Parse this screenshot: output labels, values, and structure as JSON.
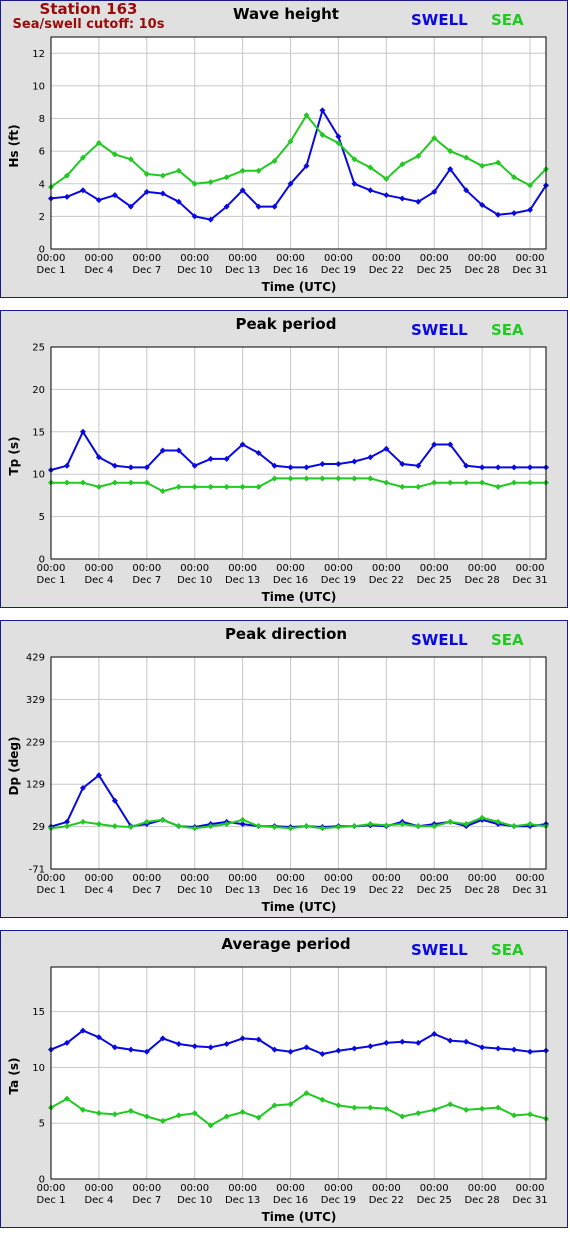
{
  "header": {
    "station": "Station 163",
    "cutoff": "Sea/swell cutoff: 10s"
  },
  "legend": {
    "swell": "SWELL",
    "sea": "SEA"
  },
  "colors": {
    "swell": "#0a0ae0",
    "sea": "#22c922",
    "header": "#9b0a0a",
    "border": "#1a1a8c"
  },
  "x_axis": {
    "label": "Time (UTC)",
    "ticks": [
      {
        "time": "00:00",
        "date": "Dec 1"
      },
      {
        "time": "00:00",
        "date": "Dec 4"
      },
      {
        "time": "00:00",
        "date": "Dec 7"
      },
      {
        "time": "00:00",
        "date": "Dec 10"
      },
      {
        "time": "00:00",
        "date": "Dec 13"
      },
      {
        "time": "00:00",
        "date": "Dec 16"
      },
      {
        "time": "00:00",
        "date": "Dec 19"
      },
      {
        "time": "00:00",
        "date": "Dec 22"
      },
      {
        "time": "00:00",
        "date": "Dec 25"
      },
      {
        "time": "00:00",
        "date": "Dec 28"
      },
      {
        "time": "00:00",
        "date": "Dec 31"
      }
    ]
  },
  "chart_data": [
    {
      "type": "line",
      "title": "Wave height",
      "ylabel": "Hs (ft)",
      "x_dates": [
        "Dec 1",
        "Dec 2",
        "Dec 3",
        "Dec 4",
        "Dec 5",
        "Dec 6",
        "Dec 7",
        "Dec 8",
        "Dec 9",
        "Dec 10",
        "Dec 11",
        "Dec 12",
        "Dec 13",
        "Dec 14",
        "Dec 15",
        "Dec 16",
        "Dec 17",
        "Dec 18",
        "Dec 19",
        "Dec 20",
        "Dec 21",
        "Dec 22",
        "Dec 23",
        "Dec 24",
        "Dec 25",
        "Dec 26",
        "Dec 27",
        "Dec 28",
        "Dec 29",
        "Dec 30",
        "Dec 31",
        "Jan 1"
      ],
      "ylim": [
        0,
        13
      ],
      "yticks": [
        0,
        2,
        4,
        6,
        8,
        10,
        12
      ],
      "series": [
        {
          "name": "SWELL",
          "color": "#0a0ae0",
          "values": [
            3.1,
            3.2,
            3.6,
            3.0,
            3.3,
            2.6,
            3.5,
            3.4,
            2.9,
            2.0,
            1.8,
            2.6,
            3.6,
            2.6,
            2.6,
            4.0,
            5.1,
            8.5,
            6.9,
            4.0,
            3.6,
            3.3,
            3.1,
            2.9,
            3.5,
            4.9,
            3.6,
            2.7,
            2.1,
            2.2,
            2.4,
            3.9
          ]
        },
        {
          "name": "SEA",
          "color": "#22c922",
          "values": [
            3.8,
            4.5,
            5.6,
            6.5,
            5.8,
            5.5,
            4.6,
            4.5,
            4.8,
            4.0,
            4.1,
            4.4,
            4.8,
            4.8,
            5.4,
            6.6,
            8.2,
            7.0,
            6.5,
            5.5,
            5.0,
            4.3,
            5.2,
            5.7,
            6.8,
            6.0,
            5.6,
            5.1,
            5.3,
            4.4,
            3.9,
            4.9
          ]
        }
      ]
    },
    {
      "type": "line",
      "title": "Peak period",
      "ylabel": "Tp (s)",
      "x_dates": [
        "Dec 1",
        "Dec 2",
        "Dec 3",
        "Dec 4",
        "Dec 5",
        "Dec 6",
        "Dec 7",
        "Dec 8",
        "Dec 9",
        "Dec 10",
        "Dec 11",
        "Dec 12",
        "Dec 13",
        "Dec 14",
        "Dec 15",
        "Dec 16",
        "Dec 17",
        "Dec 18",
        "Dec 19",
        "Dec 20",
        "Dec 21",
        "Dec 22",
        "Dec 23",
        "Dec 24",
        "Dec 25",
        "Dec 26",
        "Dec 27",
        "Dec 28",
        "Dec 29",
        "Dec 30",
        "Dec 31",
        "Jan 1"
      ],
      "ylim": [
        0,
        25
      ],
      "yticks": [
        0,
        5,
        10,
        15,
        20,
        25
      ],
      "series": [
        {
          "name": "SWELL",
          "color": "#0a0ae0",
          "values": [
            10.5,
            11.0,
            15.0,
            12.0,
            11.0,
            10.8,
            10.8,
            12.8,
            12.8,
            11.0,
            11.8,
            11.8,
            13.5,
            12.5,
            11.0,
            10.8,
            10.8,
            11.2,
            11.2,
            11.5,
            12.0,
            13.0,
            11.2,
            11.0,
            13.5,
            13.5,
            11.0,
            10.8,
            10.8,
            10.8,
            10.8,
            10.8
          ]
        },
        {
          "name": "SEA",
          "color": "#22c922",
          "values": [
            9.0,
            9.0,
            9.0,
            8.5,
            9.0,
            9.0,
            9.0,
            8.0,
            8.5,
            8.5,
            8.5,
            8.5,
            8.5,
            8.5,
            9.5,
            9.5,
            9.5,
            9.5,
            9.5,
            9.5,
            9.5,
            9.0,
            8.5,
            8.5,
            9.0,
            9.0,
            9.0,
            9.0,
            8.5,
            9.0,
            9.0,
            9.0
          ]
        }
      ]
    },
    {
      "type": "line",
      "title": "Peak direction",
      "ylabel": "Dp (deg)",
      "x_dates": [
        "Dec 1",
        "Dec 2",
        "Dec 3",
        "Dec 4",
        "Dec 5",
        "Dec 6",
        "Dec 7",
        "Dec 8",
        "Dec 9",
        "Dec 10",
        "Dec 11",
        "Dec 12",
        "Dec 13",
        "Dec 14",
        "Dec 15",
        "Dec 16",
        "Dec 17",
        "Dec 18",
        "Dec 19",
        "Dec 20",
        "Dec 21",
        "Dec 22",
        "Dec 23",
        "Dec 24",
        "Dec 25",
        "Dec 26",
        "Dec 27",
        "Dec 28",
        "Dec 29",
        "Dec 30",
        "Dec 31",
        "Jan 1"
      ],
      "ylim": [
        -71,
        429
      ],
      "yticks": [
        -71,
        29,
        129,
        229,
        329,
        429
      ],
      "series": [
        {
          "name": "SWELL",
          "color": "#0a0ae0",
          "values": [
            29,
            40,
            120,
            150,
            90,
            30,
            35,
            45,
            30,
            28,
            35,
            40,
            35,
            30,
            30,
            28,
            30,
            28,
            30,
            30,
            32,
            30,
            40,
            30,
            35,
            40,
            30,
            45,
            35,
            30,
            30,
            35
          ]
        },
        {
          "name": "SEA",
          "color": "#22c922",
          "values": [
            25,
            30,
            40,
            35,
            30,
            28,
            40,
            45,
            30,
            25,
            30,
            35,
            45,
            30,
            28,
            25,
            30,
            25,
            28,
            30,
            35,
            32,
            35,
            30,
            30,
            40,
            35,
            50,
            40,
            30,
            35,
            30
          ]
        }
      ]
    },
    {
      "type": "line",
      "title": "Average period",
      "ylabel": "Ta (s)",
      "x_dates": [
        "Dec 1",
        "Dec 2",
        "Dec 3",
        "Dec 4",
        "Dec 5",
        "Dec 6",
        "Dec 7",
        "Dec 8",
        "Dec 9",
        "Dec 10",
        "Dec 11",
        "Dec 12",
        "Dec 13",
        "Dec 14",
        "Dec 15",
        "Dec 16",
        "Dec 17",
        "Dec 18",
        "Dec 19",
        "Dec 20",
        "Dec 21",
        "Dec 22",
        "Dec 23",
        "Dec 24",
        "Dec 25",
        "Dec 26",
        "Dec 27",
        "Dec 28",
        "Dec 29",
        "Dec 30",
        "Dec 31",
        "Jan 1"
      ],
      "ylim": [
        0,
        19
      ],
      "yticks": [
        0,
        5,
        10,
        15
      ],
      "series": [
        {
          "name": "SWELL",
          "color": "#0a0ae0",
          "values": [
            11.6,
            12.2,
            13.3,
            12.7,
            11.8,
            11.6,
            11.4,
            12.6,
            12.1,
            11.9,
            11.8,
            12.1,
            12.6,
            12.5,
            11.6,
            11.4,
            11.8,
            11.2,
            11.5,
            11.7,
            11.9,
            12.2,
            12.3,
            12.2,
            13.0,
            12.4,
            12.3,
            11.8,
            11.7,
            11.6,
            11.4,
            11.5
          ]
        },
        {
          "name": "SEA",
          "color": "#22c922",
          "values": [
            6.4,
            7.2,
            6.2,
            5.9,
            5.8,
            6.1,
            5.6,
            5.2,
            5.7,
            5.9,
            4.8,
            5.6,
            6.0,
            5.5,
            6.6,
            6.7,
            7.7,
            7.1,
            6.6,
            6.4,
            6.4,
            6.3,
            5.6,
            5.9,
            6.2,
            6.7,
            6.2,
            6.3,
            6.4,
            5.7,
            5.8,
            5.4
          ]
        }
      ]
    }
  ]
}
